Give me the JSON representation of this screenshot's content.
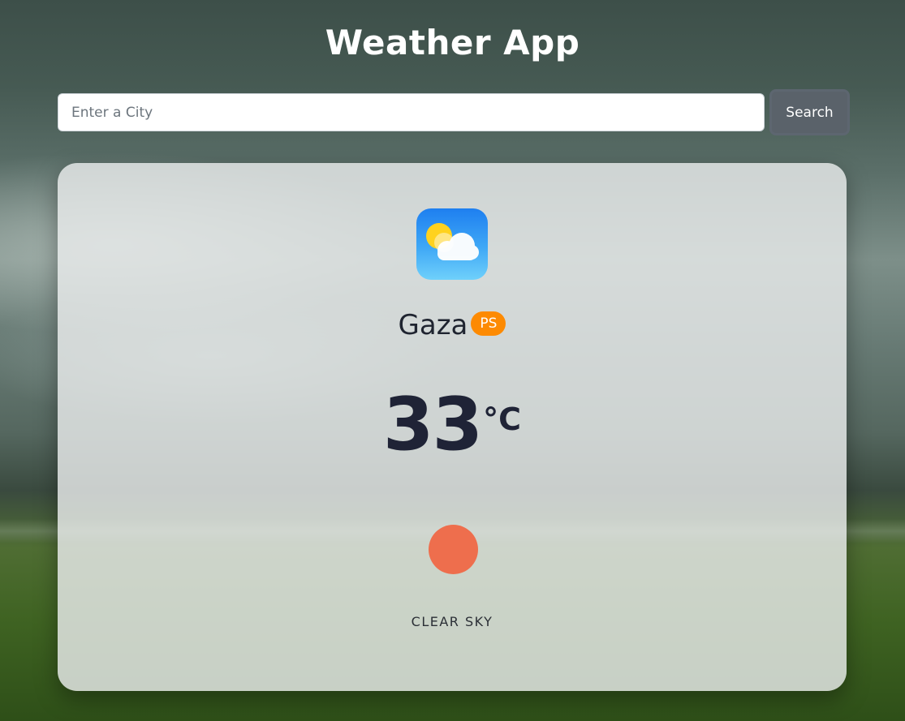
{
  "header": {
    "title": "Weather App"
  },
  "search": {
    "placeholder": "Enter a City",
    "value": "",
    "button_label": "Search"
  },
  "weather": {
    "city": "Gaza",
    "country_code": "PS",
    "temperature": "33",
    "unit": "°C",
    "description": "CLEAR SKY",
    "app_icon": "sun-behind-cloud-icon",
    "condition_icon": "sun-icon"
  },
  "colors": {
    "badge": "#fd8a02",
    "condition_icon": "#ee6e4d",
    "button": "#5a626a",
    "temperature_text": "#1f2336"
  }
}
